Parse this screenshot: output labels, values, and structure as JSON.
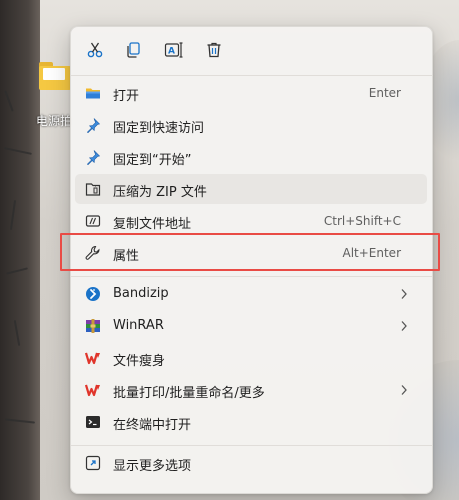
{
  "desktop": {
    "icon_label": "电源拍"
  },
  "quick_actions": [
    {
      "name": "cut",
      "icon": "scissors-icon"
    },
    {
      "name": "copy",
      "icon": "copy-icon"
    },
    {
      "name": "rename",
      "icon": "rename-icon"
    },
    {
      "name": "delete",
      "icon": "trash-icon"
    }
  ],
  "menu": {
    "items": [
      {
        "label": "打开",
        "shortcut": "Enter",
        "icon": "folder-open-icon"
      },
      {
        "label": "固定到快速访问",
        "shortcut": "",
        "icon": "pin-icon"
      },
      {
        "label": "固定到“开始”",
        "shortcut": "",
        "icon": "pin-icon"
      },
      {
        "label": "压缩为 ZIP 文件",
        "shortcut": "",
        "icon": "zip-folder-icon"
      },
      {
        "label": "复制文件地址",
        "shortcut": "Ctrl+Shift+C",
        "icon": "copy-path-icon"
      },
      {
        "label": "属性",
        "shortcut": "Alt+Enter",
        "icon": "wrench-icon"
      },
      {
        "label": "Bandizip",
        "shortcut": "",
        "icon": "bandizip-icon",
        "submenu": true
      },
      {
        "label": "WinRAR",
        "shortcut": "",
        "icon": "winrar-icon",
        "submenu": true
      },
      {
        "label": "文件瘦身",
        "shortcut": "",
        "icon": "wps-icon"
      },
      {
        "label": "批量打印/批量重命名/更多",
        "shortcut": "",
        "icon": "wps-icon",
        "submenu": true
      },
      {
        "label": "在终端中打开",
        "shortcut": "",
        "icon": "terminal-icon"
      },
      {
        "label": "显示更多选项",
        "shortcut": "",
        "icon": "more-options-icon"
      }
    ]
  },
  "colors": {
    "accent": "#1a73c8",
    "highlight_box": "#e94b45",
    "wps_red": "#e0352b"
  }
}
